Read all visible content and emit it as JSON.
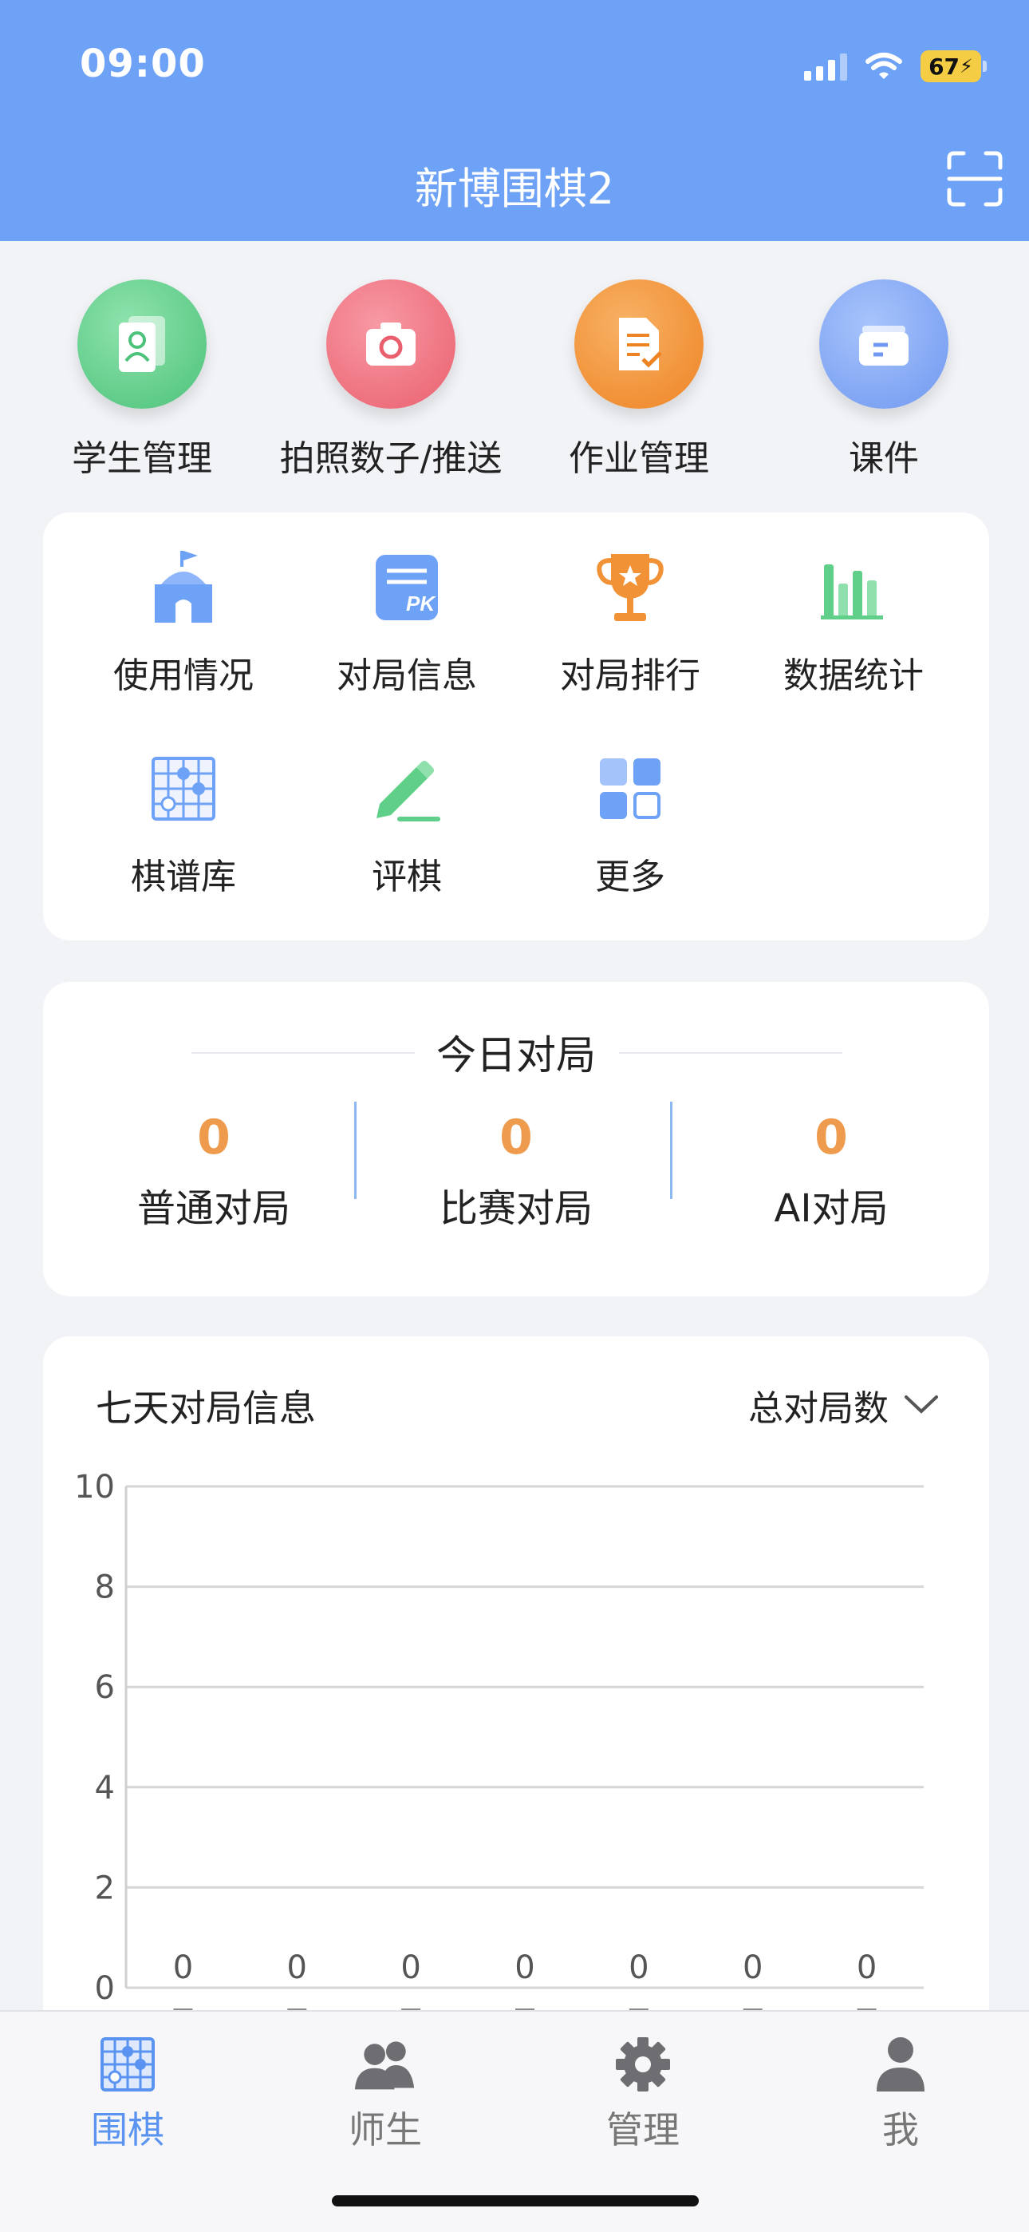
{
  "status_bar": {
    "time": "09:00",
    "battery": "67"
  },
  "header": {
    "title": "新博围棋2"
  },
  "quick_actions": [
    {
      "label": "学生管理",
      "color": "#5fcf8a"
    },
    {
      "label": "拍照数子/推送",
      "color": "#f0717e"
    },
    {
      "label": "作业管理",
      "color": "#f19237"
    },
    {
      "label": "课件",
      "color": "#7ea7f4"
    }
  ],
  "features": [
    {
      "label": "使用情况"
    },
    {
      "label": "对局信息"
    },
    {
      "label": "对局排行"
    },
    {
      "label": "数据统计"
    },
    {
      "label": "棋谱库"
    },
    {
      "label": "评棋"
    },
    {
      "label": "更多"
    }
  ],
  "today": {
    "title": "今日对局",
    "stats": [
      {
        "value": "0",
        "label": "普通对局"
      },
      {
        "value": "0",
        "label": "比赛对局"
      },
      {
        "value": "0",
        "label": "AI对局"
      }
    ]
  },
  "chart_panel": {
    "title": "七天对局信息",
    "selector": "总对局数"
  },
  "chart_data": {
    "type": "bar",
    "title": "七天对局信息",
    "ylim": [
      0,
      10
    ],
    "yticks": [
      "0",
      "2",
      "4",
      "6",
      "8",
      "10"
    ],
    "values": [
      0,
      0,
      0,
      0,
      0,
      0,
      0
    ],
    "data_labels": [
      "0",
      "0",
      "0",
      "0",
      "0",
      "0",
      "0"
    ],
    "grid": true
  },
  "tabbar": {
    "tabs": [
      {
        "label": "围棋",
        "icon": "go-board-icon",
        "active": true
      },
      {
        "label": "师生",
        "icon": "people-icon",
        "active": false
      },
      {
        "label": "管理",
        "icon": "gear-icon",
        "active": false
      },
      {
        "label": "我",
        "icon": "person-icon",
        "active": false
      }
    ]
  }
}
